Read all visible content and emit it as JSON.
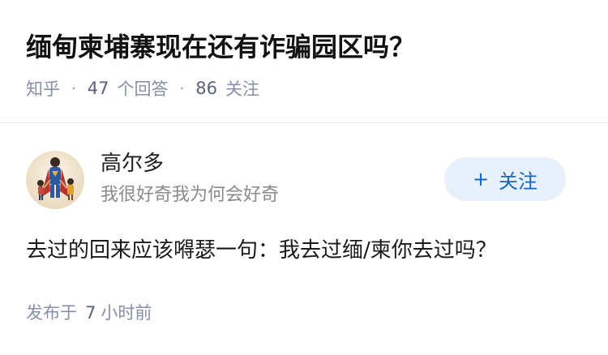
{
  "question": {
    "title": "缅甸柬埔寨现在还有诈骗园区吗？",
    "source": "知乎",
    "separator": "·",
    "answers_count": "47",
    "answers_label": "个回答",
    "follows_count": "86",
    "follows_label": "关注"
  },
  "answer": {
    "author": {
      "name": "高尔多",
      "bio": "我很好奇我为何会好奇",
      "avatar_icon": "superhero-family-avatar"
    },
    "follow_button": {
      "icon": "plus",
      "label": "关注",
      "colors": {
        "background": "#e8f1fb",
        "text": "#1565c0"
      }
    },
    "content": "去过的回来应该嘚瑟一句：我去过缅/柬你去过吗？",
    "published_prefix": "发布于",
    "published_value": "7",
    "published_unit": "小时前"
  }
}
